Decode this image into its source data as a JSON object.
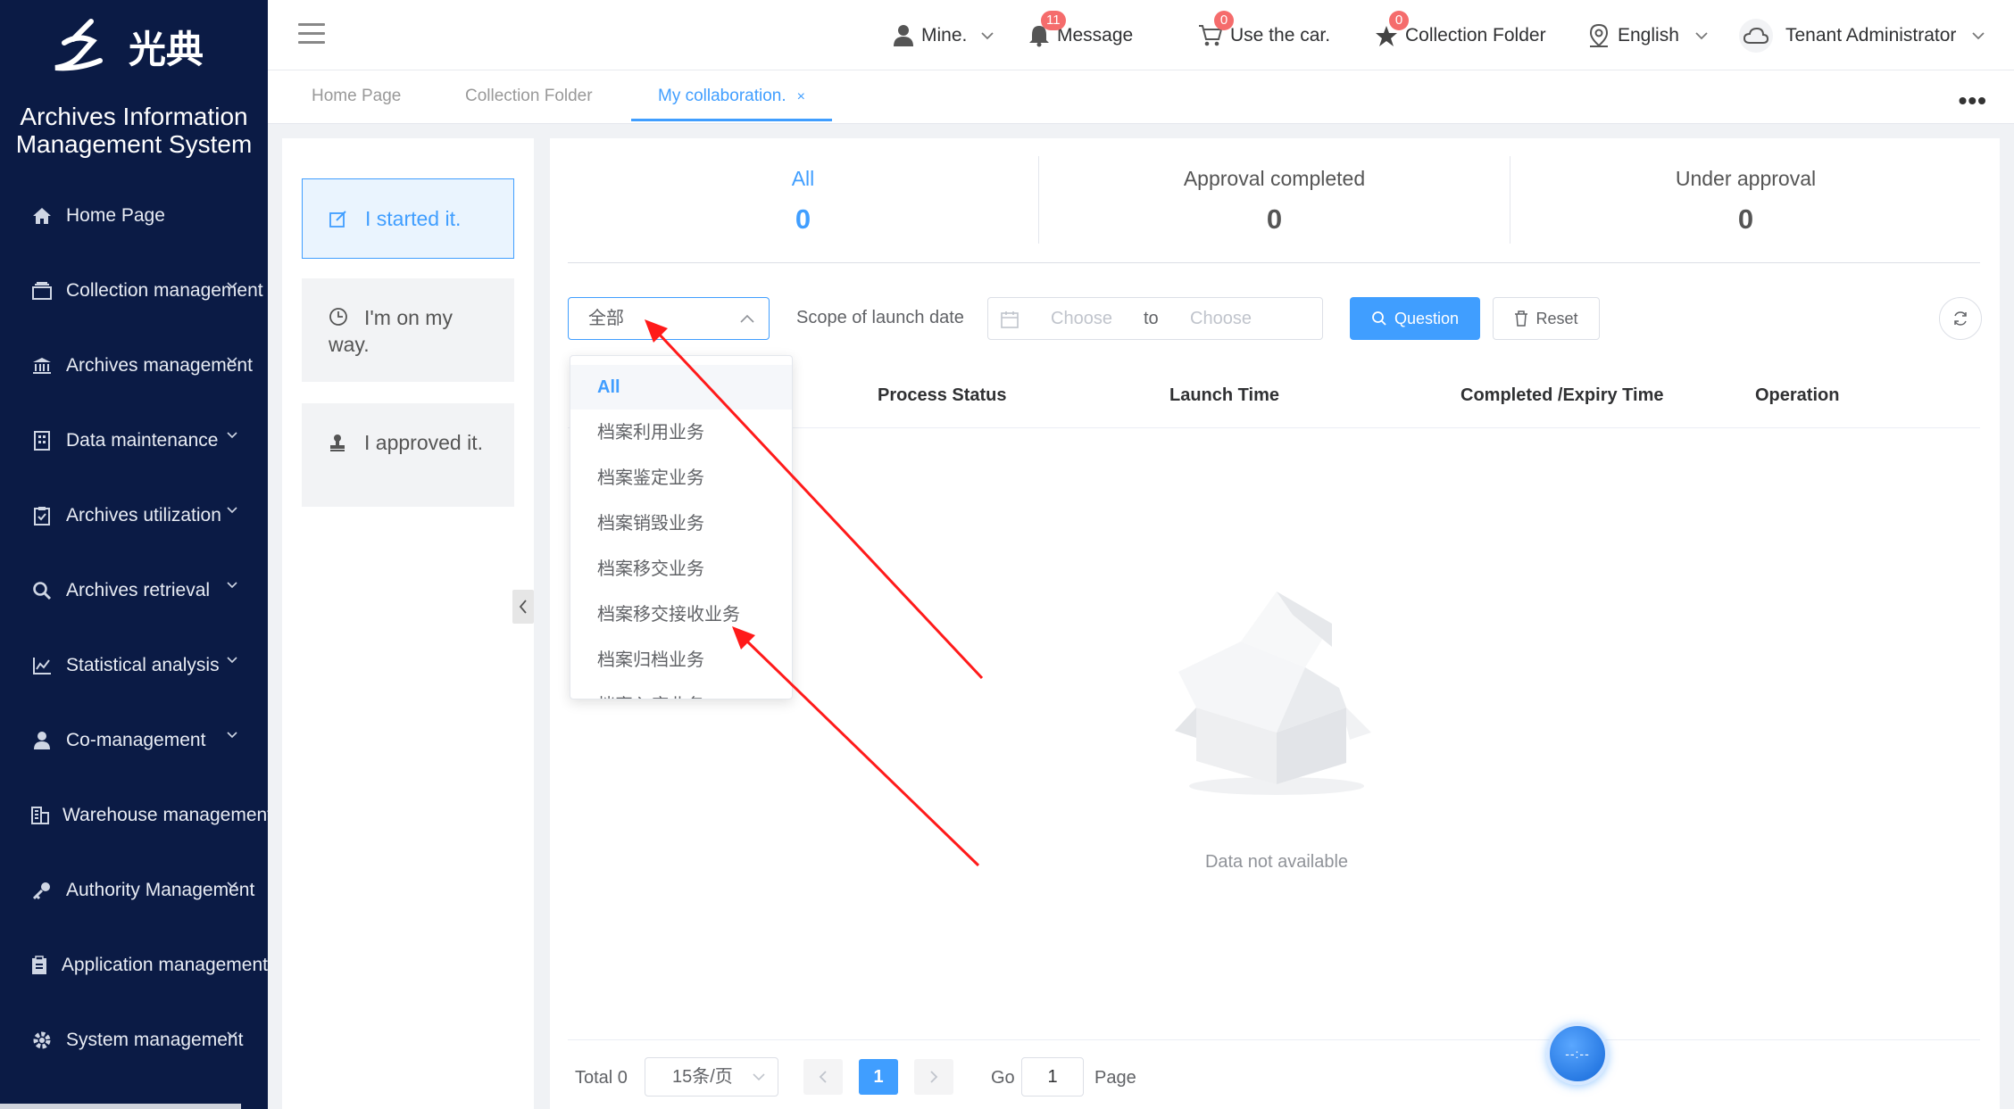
{
  "brand": {
    "logo_text": "光典",
    "system_title_line1": "Archives Information",
    "system_title_line2": "Management System"
  },
  "sidebar": {
    "items": [
      {
        "label": "Home Page",
        "icon": "home-icon",
        "expandable": false
      },
      {
        "label": "Collection management",
        "icon": "inbox-icon",
        "expandable": true
      },
      {
        "label": "Archives management",
        "icon": "bank-icon",
        "expandable": true
      },
      {
        "label": "Data maintenance",
        "icon": "building-icon",
        "expandable": true
      },
      {
        "label": "Archives utilization",
        "icon": "clipboard-check-icon",
        "expandable": true
      },
      {
        "label": "Archives retrieval",
        "icon": "search-icon",
        "expandable": true
      },
      {
        "label": "Statistical analysis",
        "icon": "chart-icon",
        "expandable": true
      },
      {
        "label": "Co-management",
        "icon": "user-group-icon",
        "expandable": true
      },
      {
        "label": "Warehouse management",
        "icon": "warehouse-icon",
        "expandable": true
      },
      {
        "label": "Authority Management",
        "icon": "key-icon",
        "expandable": true
      },
      {
        "label": "Application management",
        "icon": "clipboard-icon",
        "expandable": true
      },
      {
        "label": "System management",
        "icon": "gear-icon",
        "expandable": true
      }
    ]
  },
  "topbar": {
    "mine_label": "Mine.",
    "message_label": "Message",
    "message_badge": "11",
    "car_label": "Use the car.",
    "car_badge": "0",
    "collection_label": "Collection Folder",
    "collection_badge": "0",
    "language_label": "English",
    "user_label": "Tenant Administrator"
  },
  "tabs": [
    {
      "label": "Home Page",
      "active": false
    },
    {
      "label": "Collection Folder",
      "active": false
    },
    {
      "label": "My collaboration.",
      "active": true,
      "close": "×"
    }
  ],
  "left_panel": {
    "buttons": [
      {
        "label": "I started it.",
        "icon": "edit-icon",
        "active": true
      },
      {
        "label": "I'm on my way.",
        "icon": "clock-icon",
        "active": false
      },
      {
        "label": "I approved it.",
        "icon": "stamp-icon",
        "active": false
      }
    ]
  },
  "stats": [
    {
      "label": "All",
      "value": "0",
      "active": true
    },
    {
      "label": "Approval completed",
      "value": "0",
      "active": false
    },
    {
      "label": "Under approval",
      "value": "0",
      "active": false
    }
  ],
  "filters": {
    "business_type_value": "全部",
    "date_label": "Scope of launch date",
    "date_start_placeholder": "Choose",
    "date_separator": "to",
    "date_end_placeholder": "Choose",
    "query_label": "Question",
    "reset_label": "Reset"
  },
  "dropdown": {
    "options": [
      "All",
      "档案利用业务",
      "档案鉴定业务",
      "档案销毁业务",
      "档案移交业务",
      "档案移交接收业务",
      "档案归档业务",
      "档案入库业务"
    ],
    "selected": "All"
  },
  "table": {
    "columns": [
      "Process Status",
      "Launch Time",
      "Completed /Expiry Time",
      "Operation"
    ],
    "rows": [],
    "empty_text": "Data not available"
  },
  "pagination": {
    "total_label": "Total 0",
    "page_size": "15条/页",
    "current_page": "1",
    "go_label": "Go",
    "go_value": "1",
    "page_label": "Page"
  },
  "float_button": {
    "text": "--:--"
  },
  "colors": {
    "sidebar_bg": "#0b1b45",
    "accent": "#409eff",
    "badge": "#f56c6c",
    "annotation_arrow": "#ff1a1a"
  }
}
